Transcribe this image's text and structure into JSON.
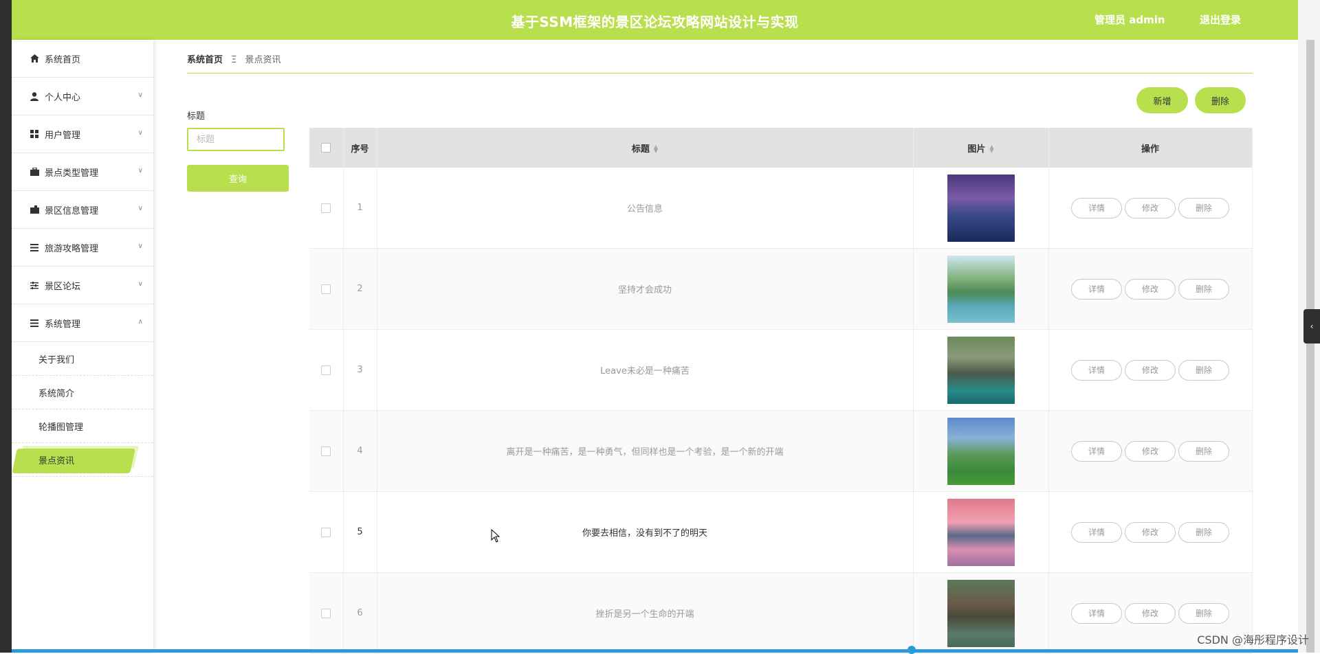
{
  "header": {
    "title": "基于SSM框架的景区论坛攻略网站设计与实现",
    "admin": "管理员 admin",
    "logout": "退出登录"
  },
  "sidebar": {
    "items": [
      {
        "label": "系统首页",
        "icon": "home-icon"
      },
      {
        "label": "个人中心",
        "icon": "user-icon"
      },
      {
        "label": "用户管理",
        "icon": "grid-icon"
      },
      {
        "label": "景点类型管理",
        "icon": "briefcase-icon"
      },
      {
        "label": "景区信息管理",
        "icon": "wallet-icon"
      },
      {
        "label": "旅游攻略管理",
        "icon": "list-icon"
      },
      {
        "label": "景区论坛",
        "icon": "sliders-icon"
      },
      {
        "label": "系统管理",
        "icon": "list-icon"
      }
    ],
    "sub_items": [
      "关于我们",
      "系统简介",
      "轮播图管理",
      "景点资讯"
    ]
  },
  "breadcrumb": {
    "home": "系统首页",
    "sep": "Ξ",
    "current": "景点资讯"
  },
  "search": {
    "label": "标题",
    "placeholder": "标题",
    "button": "查询"
  },
  "actions": {
    "add": "新增",
    "delete": "删除"
  },
  "table": {
    "headers": [
      "序号",
      "标题",
      "图片",
      "操作"
    ],
    "rows": [
      {
        "id": "1",
        "title": "公告信息"
      },
      {
        "id": "2",
        "title": "坚持才会成功"
      },
      {
        "id": "3",
        "title": "Leave未必是一种痛苦"
      },
      {
        "id": "4",
        "title": "离开是一种痛苦，是一种勇气，但同样也是一个考验，是一个新的开端"
      },
      {
        "id": "5",
        "title": "你要去相信，没有到不了的明天"
      },
      {
        "id": "6",
        "title": "挫折是另一个生命的开端"
      }
    ],
    "op_labels": {
      "detail": "详情",
      "edit": "修改",
      "delete": "删除"
    }
  },
  "watermark": "CSDN @海彤程序设计",
  "colors": {
    "accent": "#b8e04e"
  }
}
